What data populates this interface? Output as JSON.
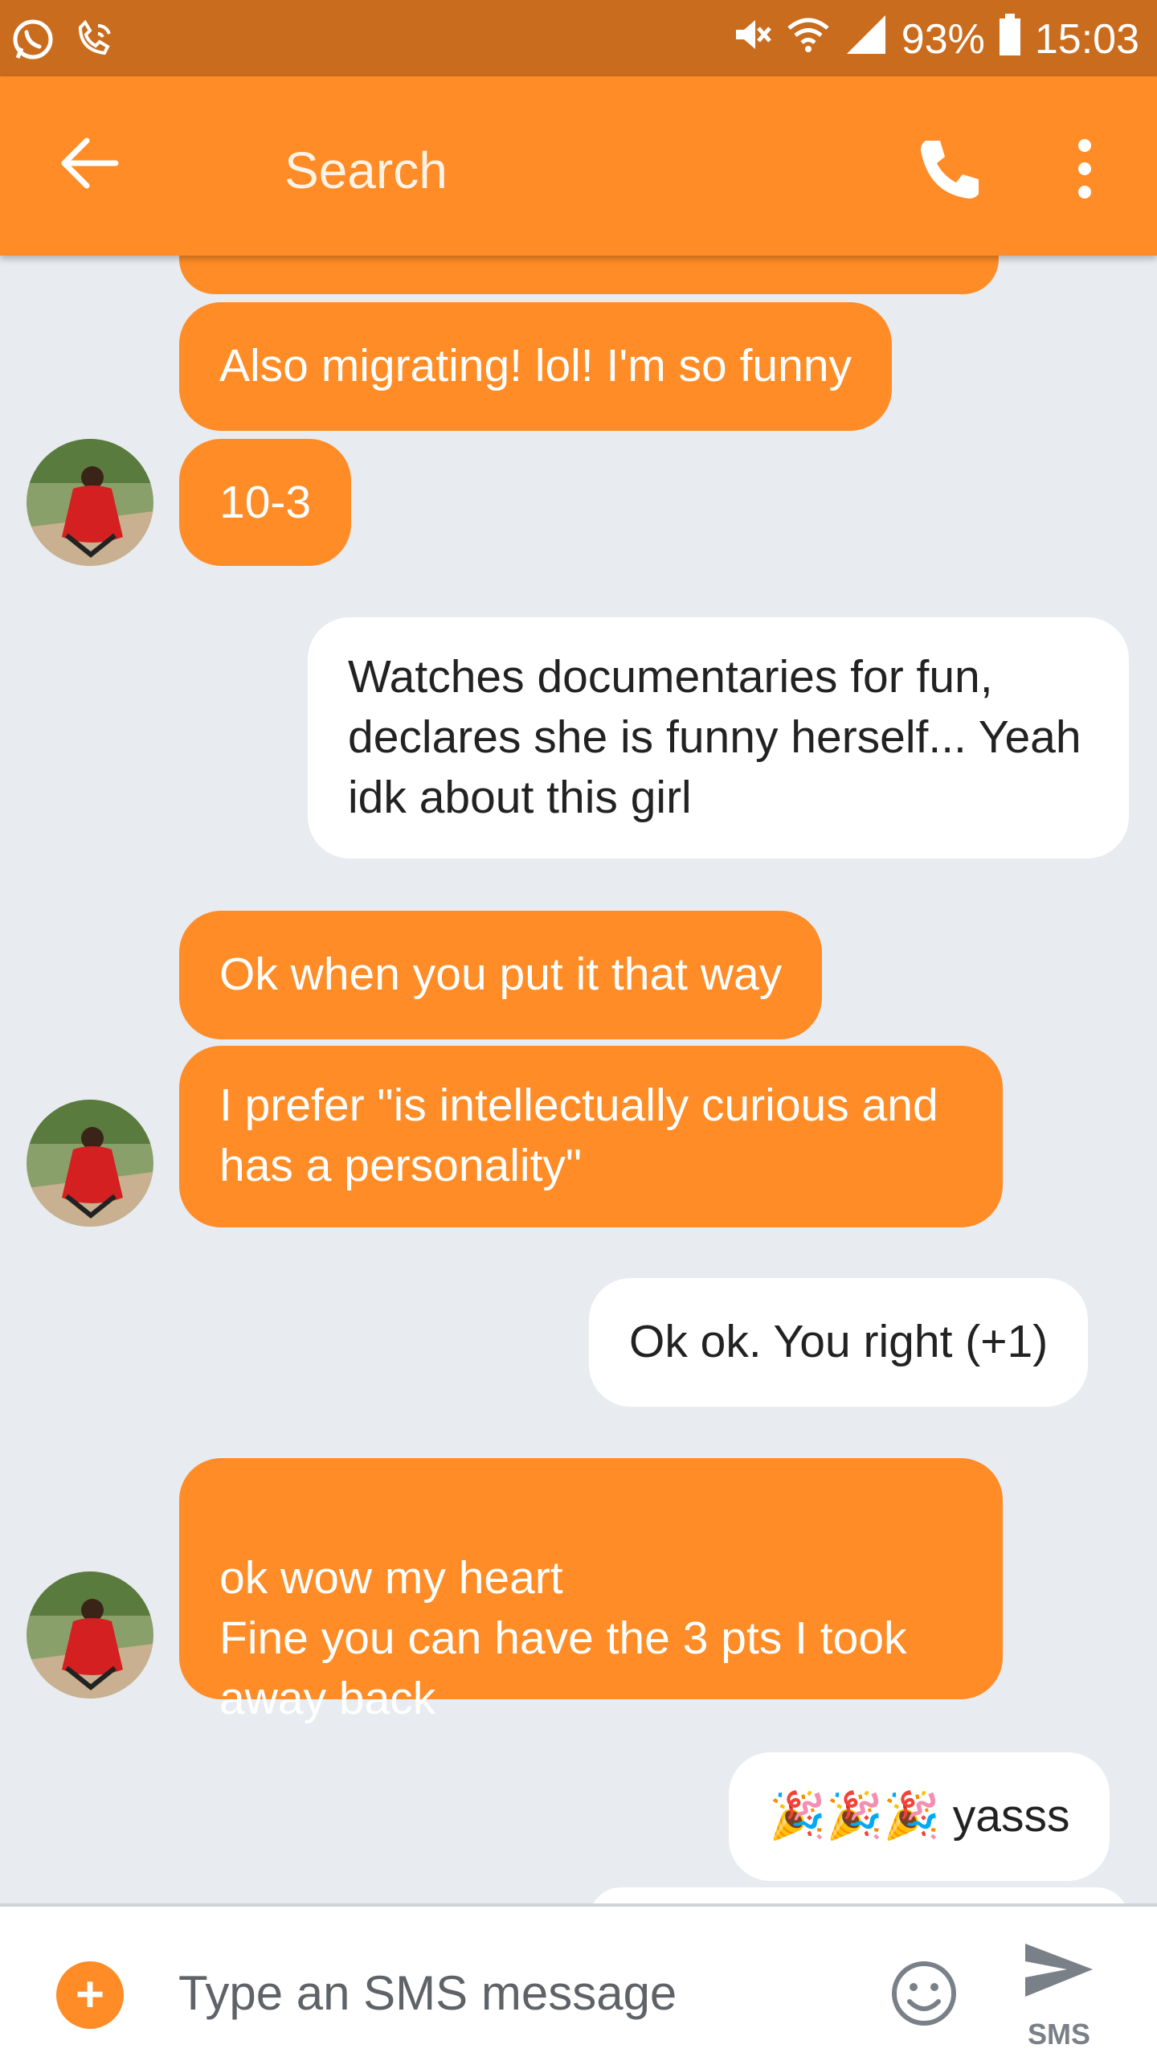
{
  "status_bar": {
    "battery": "93%",
    "time": "15:03",
    "icons": [
      "whatsapp-icon",
      "wifi-call-icon",
      "mute-icon",
      "wifi-icon",
      "signal-icon",
      "battery-icon"
    ]
  },
  "app_bar": {
    "title": "Search",
    "icons": [
      "back-arrow-icon",
      "phone-icon",
      "more-vert-icon"
    ]
  },
  "messages": [
    {
      "direction": "incoming",
      "text": "Also migrating! lol! I'm so funny"
    },
    {
      "direction": "incoming",
      "text": "10-3"
    },
    {
      "direction": "outgoing",
      "text": "Watches documentaries for fun, declares she is funny herself... Yeah idk about this girl"
    },
    {
      "direction": "incoming",
      "text": "Ok when you put it that way"
    },
    {
      "direction": "incoming",
      "text": "I prefer \"is intellectually curious and has a personality\""
    },
    {
      "direction": "outgoing",
      "text": "Ok ok. You right (+1)"
    },
    {
      "direction": "incoming",
      "text": "ok wow my heart\nFine you can have the 3 pts I took away back"
    },
    {
      "direction": "outgoing",
      "text": "🎉🎉🎉 yasss"
    }
  ],
  "composer": {
    "placeholder": "Type an SMS message",
    "send_label": "SMS"
  },
  "colors": {
    "accent": "#ff8c26",
    "status_bar": "#c96c1e",
    "background": "#e8ebef",
    "outgoing_bubble": "#ffffff"
  }
}
